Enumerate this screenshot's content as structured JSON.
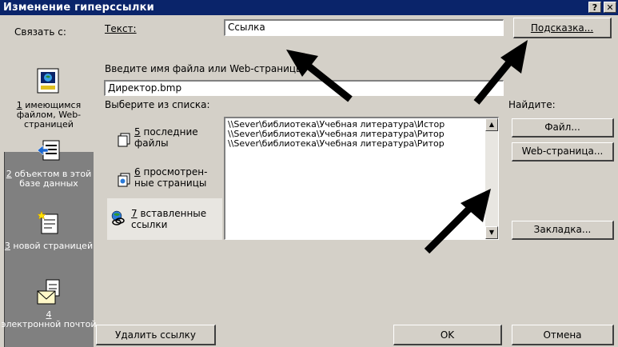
{
  "window": {
    "title": "Изменение гиперссылки",
    "help_button": "?",
    "close_button": "✕"
  },
  "linkbar": {
    "heading": "Связать с:",
    "items": [
      {
        "key": "1",
        "label": "имеющимся файлом, Web-страницей",
        "icon": "existing-file-icon",
        "selected": true
      },
      {
        "key": "2",
        "label": "объектом в этой базе данных",
        "icon": "database-object-icon",
        "selected": false
      },
      {
        "key": "3",
        "label": "новой страницей",
        "icon": "new-page-icon",
        "selected": false
      },
      {
        "key": "4",
        "label": "электронной почтой",
        "icon": "email-icon",
        "selected": false
      }
    ]
  },
  "text_row": {
    "label": "Текст:",
    "value": "Ссылка",
    "hint_button": "Подсказка..."
  },
  "address": {
    "label": "Введите имя файла или Web-страницы:",
    "value": "Директор.bmp"
  },
  "browse": {
    "label": "Выберите из списка:",
    "find_label": "Найдите:",
    "file_button": "Файл...",
    "web_button": "Web-страница...",
    "bookmark_button": "Закладка..."
  },
  "tabs": [
    {
      "key": "5",
      "label1": "последние",
      "label2": "файлы",
      "icon": "recent-files-icon"
    },
    {
      "key": "6",
      "label1": "просмотрен-",
      "label2": "ные страницы",
      "icon": "browsed-pages-icon"
    },
    {
      "key": "7",
      "label1": "вставленные",
      "label2": "ссылки",
      "icon": "inserted-links-icon"
    }
  ],
  "list": {
    "rows": [
      "\\\\Sever\\библиотека\\Учебная литература\\Истор",
      "\\\\Sever\\библиотека\\Учебная литература\\Ритор",
      "\\\\Sever\\библиотека\\Учебная литература\\Ритор"
    ]
  },
  "footer": {
    "remove_link": "Удалить ссылку",
    "ok": "OK",
    "cancel": "Отмена"
  },
  "colors": {
    "title_bar": "#0a246a",
    "face": "#d4d0c8",
    "shadow": "#808080"
  }
}
